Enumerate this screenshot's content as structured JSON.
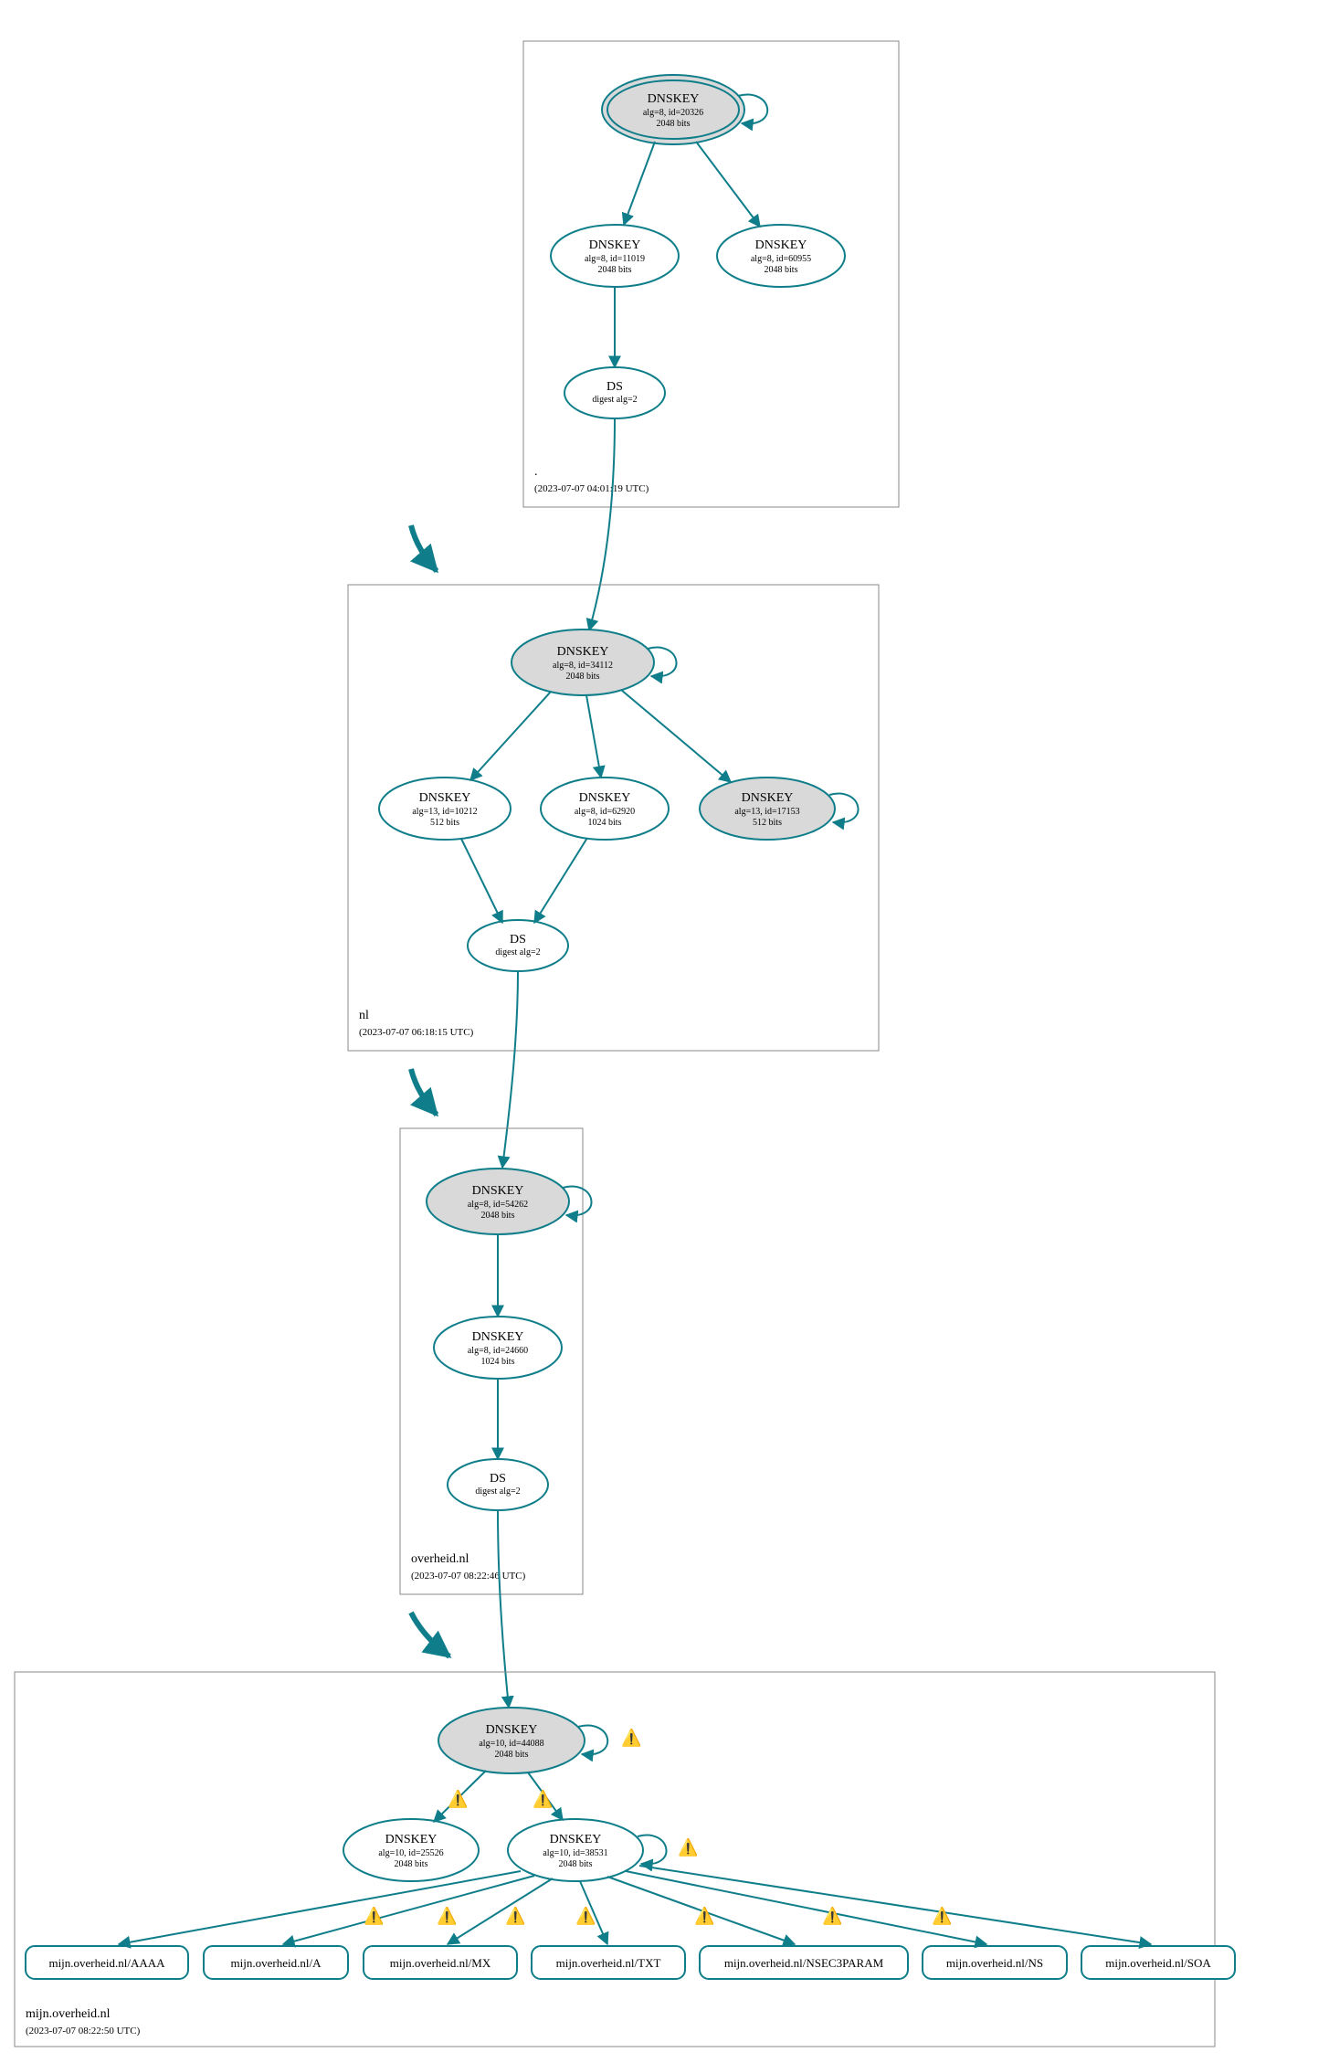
{
  "chart_data": {
    "type": "diagram",
    "title": "DNSSEC authentication chain for mijn.overheid.nl",
    "zones": [
      {
        "id": "root",
        "label": ".",
        "timestamp": "(2023-07-07 04:01:19 UTC)"
      },
      {
        "id": "nl",
        "label": "nl",
        "timestamp": "(2023-07-07 06:18:15 UTC)"
      },
      {
        "id": "overheid",
        "label": "overheid.nl",
        "timestamp": "(2023-07-07 08:22:46 UTC)"
      },
      {
        "id": "mijn",
        "label": "mijn.overheid.nl",
        "timestamp": "(2023-07-07 08:22:50 UTC)"
      }
    ],
    "nodes": {
      "root_ksk": {
        "title": "DNSKEY",
        "l1": "alg=8, id=20326",
        "l2": "2048 bits",
        "ksk": true,
        "double": true,
        "self": true
      },
      "root_zsk1": {
        "title": "DNSKEY",
        "l1": "alg=8, id=11019",
        "l2": "2048 bits"
      },
      "root_zsk2": {
        "title": "DNSKEY",
        "l1": "alg=8, id=60955",
        "l2": "2048 bits"
      },
      "root_ds": {
        "title": "DS",
        "l1": "digest alg=2",
        "l2": ""
      },
      "nl_ksk": {
        "title": "DNSKEY",
        "l1": "alg=8, id=34112",
        "l2": "2048 bits",
        "ksk": true,
        "self": true
      },
      "nl_k1": {
        "title": "DNSKEY",
        "l1": "alg=13, id=10212",
        "l2": "512 bits"
      },
      "nl_k2": {
        "title": "DNSKEY",
        "l1": "alg=8, id=62920",
        "l2": "1024 bits"
      },
      "nl_k3": {
        "title": "DNSKEY",
        "l1": "alg=13, id=17153",
        "l2": "512 bits",
        "ksk": true,
        "self": true
      },
      "nl_ds": {
        "title": "DS",
        "l1": "digest alg=2",
        "l2": ""
      },
      "ov_ksk": {
        "title": "DNSKEY",
        "l1": "alg=8, id=54262",
        "l2": "2048 bits",
        "ksk": true,
        "self": true
      },
      "ov_zsk": {
        "title": "DNSKEY",
        "l1": "alg=8, id=24660",
        "l2": "1024 bits"
      },
      "ov_ds": {
        "title": "DS",
        "l1": "digest alg=2",
        "l2": ""
      },
      "mj_ksk": {
        "title": "DNSKEY",
        "l1": "alg=10, id=44088",
        "l2": "2048 bits",
        "ksk": true,
        "self": true,
        "warn": true
      },
      "mj_z1": {
        "title": "DNSKEY",
        "l1": "alg=10, id=25526",
        "l2": "2048 bits"
      },
      "mj_z2": {
        "title": "DNSKEY",
        "l1": "alg=10, id=38531",
        "l2": "2048 bits",
        "self": true,
        "warn": true
      }
    },
    "edges": [
      [
        "root_ksk",
        "root_zsk1"
      ],
      [
        "root_ksk",
        "root_zsk2"
      ],
      [
        "root_zsk1",
        "root_ds"
      ],
      [
        "root_ds",
        "nl_ksk"
      ],
      [
        "nl_ksk",
        "nl_k1"
      ],
      [
        "nl_ksk",
        "nl_k2"
      ],
      [
        "nl_ksk",
        "nl_k3"
      ],
      [
        "nl_k1",
        "nl_ds"
      ],
      [
        "nl_k2",
        "nl_ds"
      ],
      [
        "nl_ds",
        "ov_ksk"
      ],
      [
        "ov_ksk",
        "ov_zsk"
      ],
      [
        "ov_zsk",
        "ov_ds"
      ],
      [
        "ov_ds",
        "mj_ksk"
      ],
      [
        "mj_ksk",
        "mj_z1",
        "warn"
      ],
      [
        "mj_ksk",
        "mj_z2",
        "warn"
      ],
      [
        "mj_z2",
        "aaaa",
        "warn"
      ],
      [
        "mj_z2",
        "a",
        "warn"
      ],
      [
        "mj_z2",
        "mx",
        "warn"
      ],
      [
        "mj_z2",
        "txt",
        "warn"
      ],
      [
        "mj_z2",
        "nsec3",
        "warn"
      ],
      [
        "mj_z2",
        "ns",
        "warn"
      ],
      [
        "mj_z2",
        "soa",
        "warn"
      ]
    ],
    "leaves": {
      "aaaa": "mijn.overheid.nl/AAAA",
      "a": "mijn.overheid.nl/A",
      "mx": "mijn.overheid.nl/MX",
      "txt": "mijn.overheid.nl/TXT",
      "nsec3": "mijn.overheid.nl/NSEC3PARAM",
      "ns": "mijn.overheid.nl/NS",
      "soa": "mijn.overheid.nl/SOA"
    }
  }
}
